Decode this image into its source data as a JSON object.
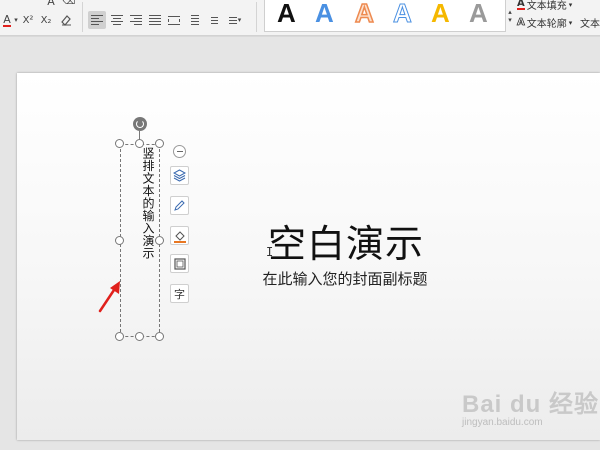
{
  "ribbon": {
    "superscript_glyph": "X²",
    "subscript_glyph": "X₂",
    "font_color_glyph": "A",
    "wordart_glyphs": [
      "A",
      "A",
      "A",
      "A",
      "A",
      "A"
    ],
    "wordart_colors": [
      "#111111",
      "#4a90e2",
      "#f0a070",
      "#4a90e2",
      "#f5b800",
      "#888888"
    ],
    "text_fill_label": "文本填充",
    "text_outline_label": "文本轮廓",
    "text_effect_label": "文本"
  },
  "slide": {
    "title": "空白演示",
    "subtitle": "在此输入您的封面副标题",
    "vertical_text": "竖排文本的输入演示"
  },
  "floating_toolbar": {
    "text_tool_glyph": "字"
  },
  "watermark": {
    "brand": "Bai du 经验",
    "url": "jingyan.baidu.com"
  },
  "colors": {
    "arrow": "#e0201c",
    "accent_orange": "#e87722"
  }
}
